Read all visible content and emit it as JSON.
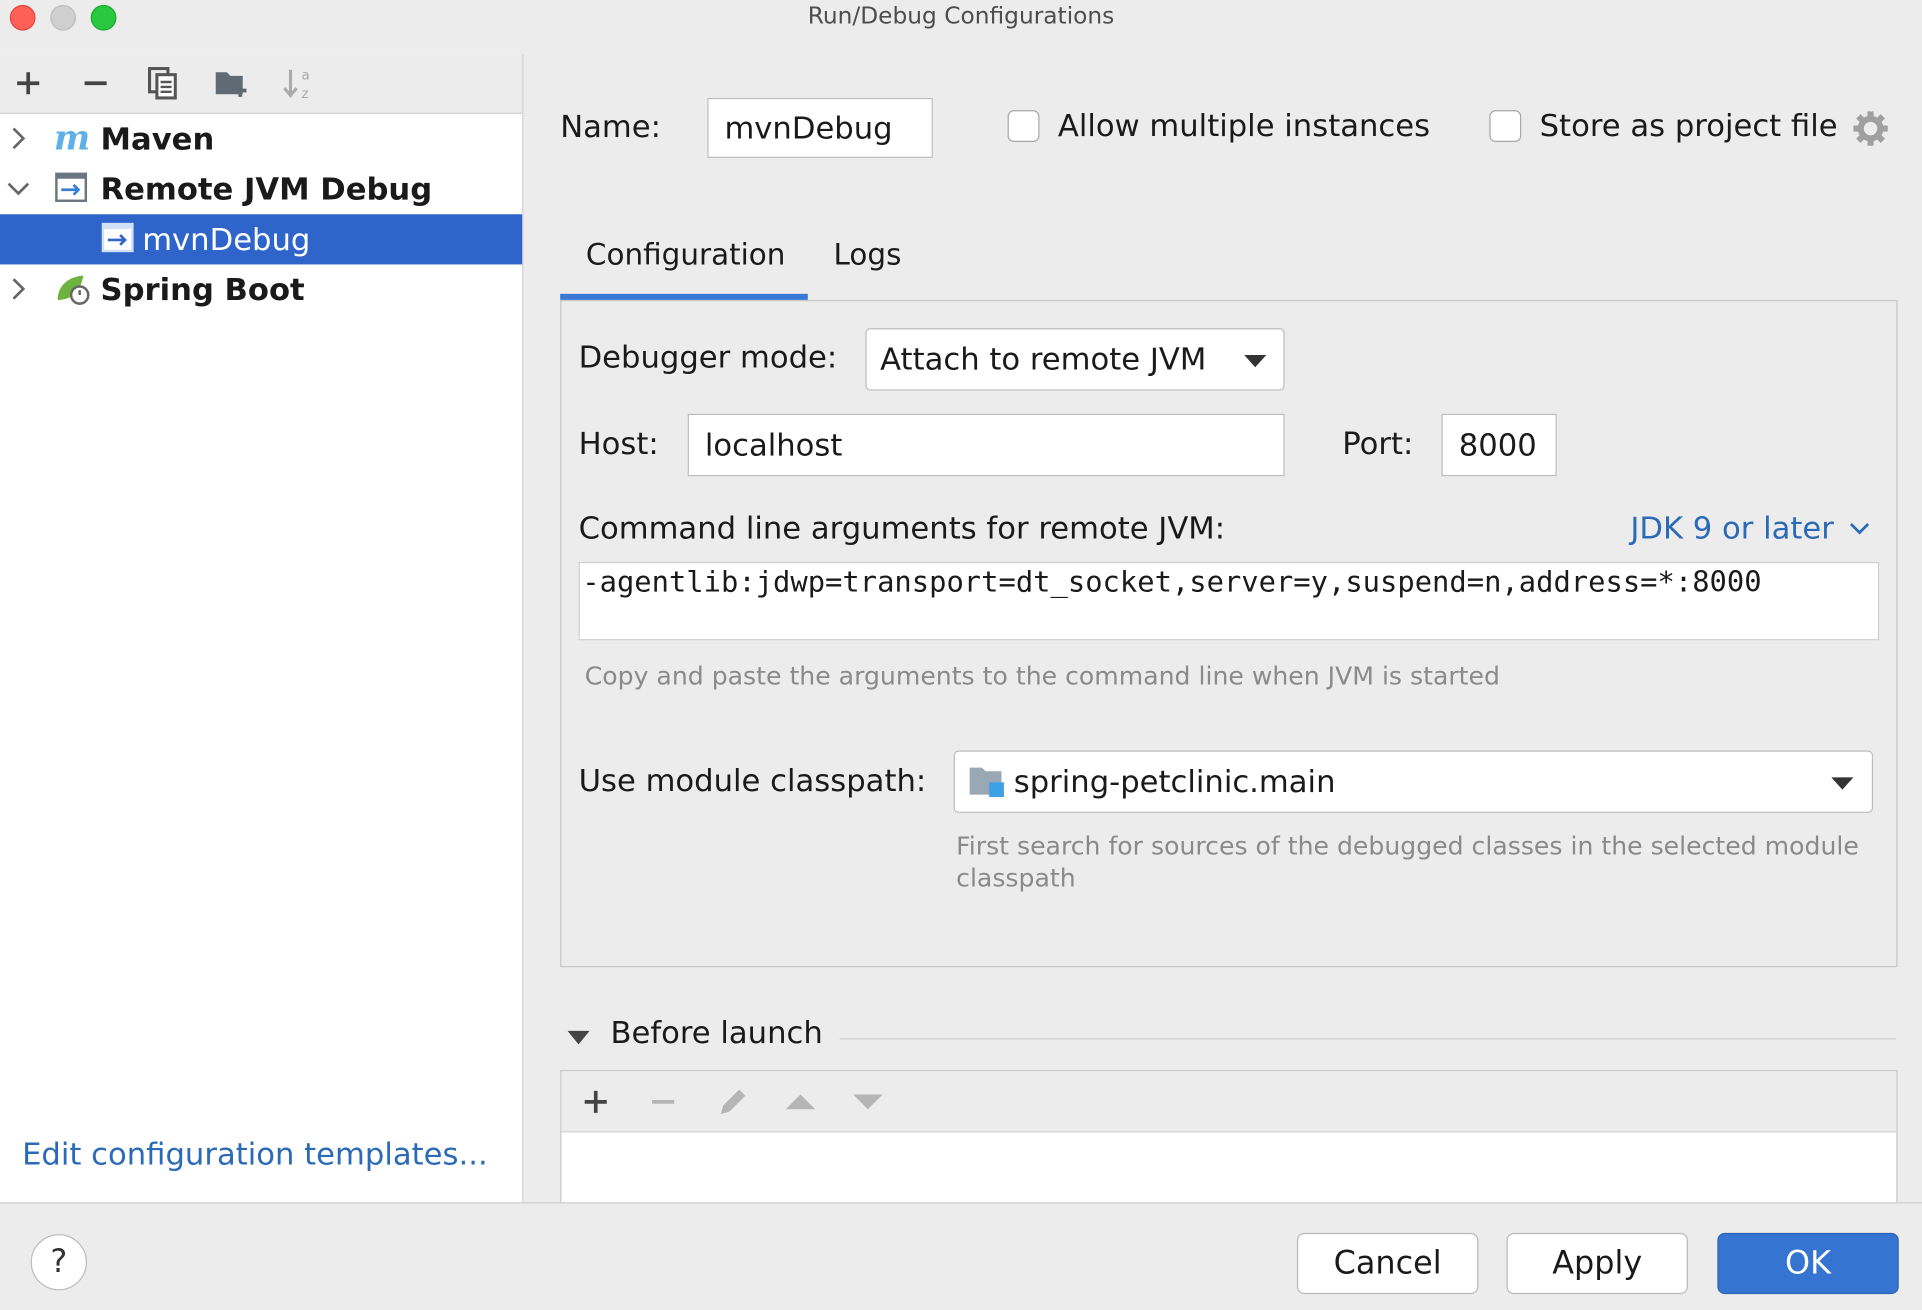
{
  "window": {
    "title": "Run/Debug Configurations"
  },
  "toolbar": {
    "icons": [
      "add-icon",
      "remove-icon",
      "copy-icon",
      "new-folder-icon",
      "sort-icon"
    ]
  },
  "tree": {
    "items": [
      {
        "label": "Maven",
        "icon": "maven-icon",
        "expanded": false
      },
      {
        "label": "Remote JVM Debug",
        "icon": "remote-debug-icon",
        "expanded": true
      },
      {
        "label": "mvnDebug",
        "icon": "remote-debug-icon",
        "selected": true
      },
      {
        "label": "Spring Boot",
        "icon": "spring-boot-icon",
        "expanded": false
      }
    ]
  },
  "edit_templates_link": "Edit configuration templates...",
  "config": {
    "name_label": "Name:",
    "name_value": "mvnDebug",
    "allow_multiple_label": "Allow multiple instances",
    "store_project_label": "Store as project file",
    "tabs": [
      "Configuration",
      "Logs"
    ],
    "active_tab": "Configuration",
    "debugger_mode_label": "Debugger mode:",
    "debugger_mode_value": "Attach to remote JVM",
    "host_label": "Host:",
    "host_value": "localhost",
    "port_label": "Port:",
    "port_value": "8000",
    "cmd_args_label": "Command line arguments for remote JVM:",
    "jdk_link": "JDK 9 or later",
    "cmd_args_value": "-agentlib:jdwp=transport=dt_socket,server=y,suspend=n,address=*:8000",
    "cmd_hint": "Copy and paste the arguments to the command line when JVM is started",
    "classpath_label": "Use module classpath:",
    "classpath_value": "spring-petclinic.main",
    "classpath_hint": "First search for sources of the debugged classes in the selected module classpath"
  },
  "before_launch": {
    "title": "Before launch",
    "icons": [
      "add-icon",
      "remove-icon",
      "edit-icon",
      "move-up-icon",
      "move-down-icon"
    ]
  },
  "buttons": {
    "help": "?",
    "cancel": "Cancel",
    "apply": "Apply",
    "ok": "OK"
  },
  "colors": {
    "selection": "#2f65ca",
    "link": "#2a6ab7",
    "ok_button": "#3574d0",
    "tab_underline": "#3a78d6"
  }
}
